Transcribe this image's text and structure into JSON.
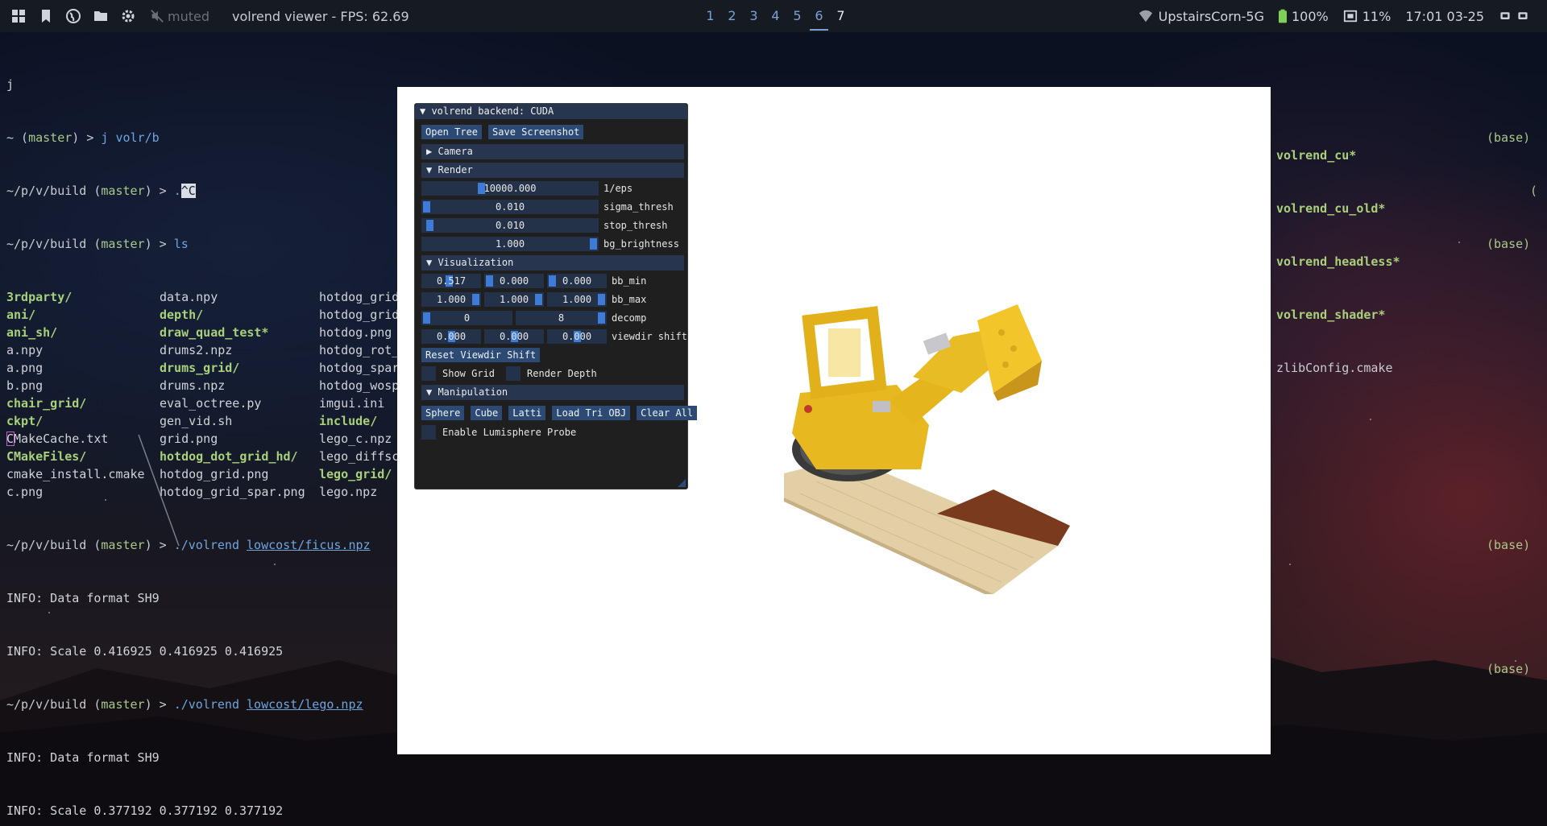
{
  "topbar": {
    "muted_label": "muted",
    "window_title": "volrend viewer - FPS: 62.69",
    "workspaces": [
      "1",
      "2",
      "3",
      "4",
      "5",
      "6",
      "7"
    ],
    "active_workspace": "6",
    "wifi_name": "UpstairsCorn-5G",
    "battery": "100%",
    "cpu": "11%",
    "clock": "17:01 03-25",
    "icons": [
      "grid-icon",
      "bookmark-icon",
      "globe-icon",
      "folder-icon",
      "gear-icon",
      "speaker-muted-icon",
      "wifi-icon",
      "battery-icon",
      "cpu-icon",
      "tray-icon"
    ]
  },
  "terminal": {
    "line0": "j",
    "prompt_home": "~",
    "branch_open": " (",
    "branch": "master",
    "branch_close": ") > ",
    "cmd1": "j volr/b",
    "prompt_build": "~/p/v/build",
    "cmd2_prefix": ".",
    "cmd2_sel": "^C",
    "cmd3": "ls",
    "ls_col1": [
      "3rdparty/",
      "ani/",
      "ani_sh/",
      "a.npy",
      "a.png",
      "b.png",
      "chair_grid/",
      "ckpt/",
      "CMakeCache.txt",
      "CMakeFiles/",
      "cmake_install.cmake",
      "c.png"
    ],
    "ls_col2": [
      "data.npy",
      "depth/",
      "draw_quad_test*",
      "drums2.npz",
      "drums_grid/",
      "drums.npz",
      "eval_octree.py",
      "gen_vid.sh",
      "grid.png",
      "hotdog_dot_grid_hd/",
      "hotdog_grid.png",
      "hotdog_grid_spar.png"
    ],
    "ls_col3": [
      "hotdog_grid",
      "hotdog_grid",
      "hotdog.png",
      "hotdog_rot_",
      "hotdog_spar",
      "hotdog_wosp",
      "imgui.ini",
      "include/",
      "lego_c.npz",
      "lego_diffsc",
      "lego_grid/",
      "lego.npz"
    ],
    "run_cmd": "./volrend ",
    "run1_file": "lowcost/ficus.npz",
    "info1a": "INFO: Data format SH9",
    "info1b": "INFO: Scale 0.416925 0.416925 0.416925",
    "run2_file": "lowcost/lego.npz",
    "info2a": "INFO: Data format SH9",
    "info2b": "INFO: Scale 0.377192 0.377192 0.377192",
    "base": "(base)",
    "paren": "(",
    "right_files": [
      "volrend_cu*",
      "volrend_cu_old*",
      "volrend_headless*",
      "volrend_shader*",
      "zlibConfig.cmake"
    ]
  },
  "imgui": {
    "title": "▼ volrend backend: CUDA",
    "open_tree": "Open Tree",
    "save_screenshot": "Save Screenshot",
    "camera_header": "▶  Camera",
    "render_header": "▼  Render",
    "sliders_render": [
      {
        "value": "10000.000",
        "label": "1/eps",
        "level": 0.33
      },
      {
        "value": "0.010",
        "label": "sigma_thresh",
        "level": 0.0
      },
      {
        "value": "0.010",
        "label": "stop_thresh",
        "level": 0.02
      },
      {
        "value": "1.000",
        "label": "bg_brightness",
        "level": 1.0
      }
    ],
    "vis_header": "▼  Visualization",
    "bb_min": {
      "values": [
        "0.517",
        "0.000",
        "0.000"
      ],
      "label": "bb_min"
    },
    "bb_max": {
      "values": [
        "1.000",
        "1.000",
        "1.000"
      ],
      "label": "bb_max"
    },
    "decomp": {
      "values": [
        "0",
        "8"
      ],
      "label": "decomp"
    },
    "viewdir": {
      "values": [
        "0.000",
        "0.000",
        "0.000"
      ],
      "label": "viewdir shift"
    },
    "reset_viewdir": "Reset Viewdir Shift",
    "show_grid": "Show Grid",
    "render_depth": "Render Depth",
    "manip_header": "▼  Manipulation",
    "manip_buttons": [
      "Sphere",
      "Cube",
      "Latti",
      "Load Tri OBJ",
      "Clear All"
    ],
    "lumisphere": "Enable Lumisphere Probe"
  },
  "colors": {
    "imgui_bg": "#161616",
    "imgui_header": "#27354e",
    "imgui_button": "#2c4a74",
    "imgui_slider": "#233149",
    "imgui_grab": "#3d7bd6",
    "topbar_bg": "#161a21",
    "prompt_green": "#a9c98a",
    "link_blue": "#6fa5de"
  }
}
